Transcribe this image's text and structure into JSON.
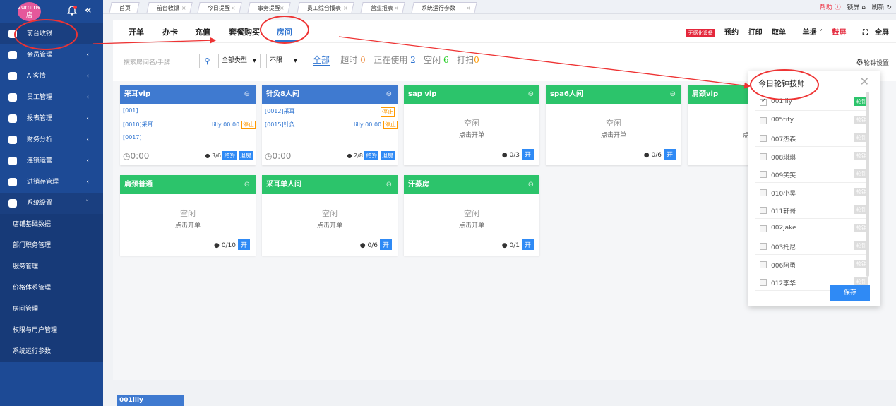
{
  "sidebar": {
    "avatar_text": "summer5A店",
    "items": [
      {
        "label": "前台收银",
        "active": true,
        "has_arrow": false
      },
      {
        "label": "会员管理",
        "has_arrow": true
      },
      {
        "label": "AI客情",
        "has_arrow": true
      },
      {
        "label": "员工管理",
        "has_arrow": true
      },
      {
        "label": "报表管理",
        "has_arrow": true
      },
      {
        "label": "财务分析",
        "has_arrow": true
      },
      {
        "label": "连锁运营",
        "has_arrow": true
      },
      {
        "label": "进销存管理",
        "has_arrow": true
      },
      {
        "label": "系统设置",
        "has_arrow": true,
        "open": true
      }
    ],
    "sub_items": [
      "店铺基础数据",
      "部门职务管理",
      "服务管理",
      "价格体系管理",
      "房间管理",
      "权限与用户管理",
      "系统运行参数"
    ]
  },
  "top_tabs": [
    "首页",
    "前台收银",
    "今日提醒",
    "事务提醒",
    "员工综合报表",
    "营业报表",
    "系统运行参数"
  ],
  "top_right": {
    "help": "帮助",
    "lock": "锁屏",
    "refresh": "刷新"
  },
  "sub_tabs": [
    "开单",
    "办卡",
    "充值",
    "套餐购买",
    "房间"
  ],
  "toolbar": {
    "ad": "无感化设备",
    "items": [
      "预约",
      "打印",
      "取单",
      "单据",
      "鼓屏",
      "全屏"
    ]
  },
  "filter": {
    "search_placeholder": "搜索房间名/手牌",
    "type_select": "全部类型",
    "limit_select": "不限",
    "all": "全部",
    "timeout_label": "超时",
    "timeout_count": "0",
    "inuse_label": "正在使用",
    "inuse_count": "2",
    "idle_label": "空闲",
    "idle_count": "6",
    "clean_label": "打扫",
    "clean_count": "0",
    "rotation_setting": "轮钟设置"
  },
  "rooms": [
    {
      "name": "采耳vip",
      "status": "busy",
      "color": "#3f7ad0",
      "lines": [
        "[001]",
        "[0010]采耳",
        "[0017]"
      ],
      "who": "lilly 00:00",
      "stop": "停止",
      "timer": "0:00",
      "count": "3/6",
      "btn1": "结算",
      "btn2": "退房"
    },
    {
      "name": "针灸8人间",
      "status": "busy",
      "color": "#3f7ad0",
      "lines": [
        "[0012]采耳",
        "[0015]针灸"
      ],
      "who": "lilly 00:00",
      "stop": "停止",
      "stop_top": "停止",
      "timer": "0:00",
      "count": "2/8",
      "btn1": "结算",
      "btn2": "退房"
    },
    {
      "name": "sap vip",
      "status": "idle",
      "count": "0/3"
    },
    {
      "name": "spa6人间",
      "status": "idle",
      "count": "0/6"
    },
    {
      "name": "肩颈vip",
      "status": "idle",
      "count": ""
    },
    {
      "name": "肩颈普通",
      "status": "idle",
      "count": "0/10"
    },
    {
      "name": "采耳单人间",
      "status": "idle",
      "count": "0/6"
    },
    {
      "name": "汗蒸房",
      "status": "idle",
      "count": "0/1"
    }
  ],
  "idle_text": "空闲",
  "idle_sub": "点击开单",
  "open_btn": "开",
  "bottom_tag": "001lily",
  "popup": {
    "title": "今日轮钟技师",
    "tag": "轮钟",
    "save": "保存",
    "techs": [
      {
        "name": "001lily",
        "checked": true
      },
      {
        "name": "005tity",
        "checked": false
      },
      {
        "name": "007杰森",
        "checked": false
      },
      {
        "name": "008琪琪",
        "checked": false
      },
      {
        "name": "009笑笑",
        "checked": false
      },
      {
        "name": "010小昊",
        "checked": false
      },
      {
        "name": "011轩哥",
        "checked": false
      },
      {
        "name": "002jake",
        "checked": false
      },
      {
        "name": "003托尼",
        "checked": false
      },
      {
        "name": "006阿勇",
        "checked": false
      },
      {
        "name": "012李华",
        "checked": false
      }
    ]
  }
}
